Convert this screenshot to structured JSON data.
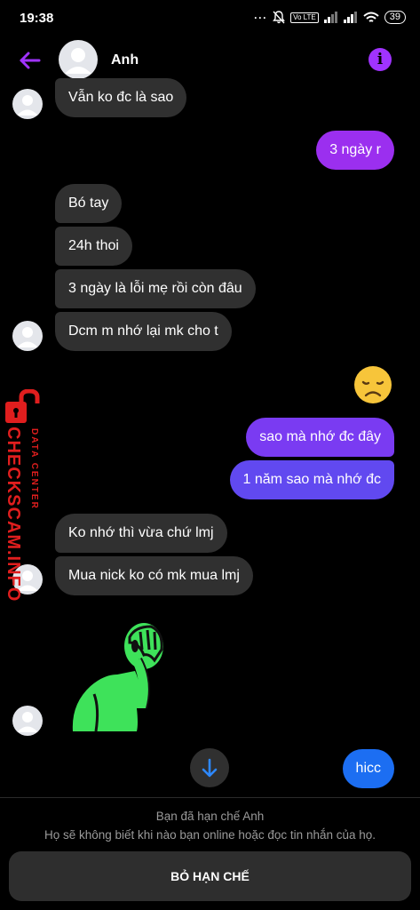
{
  "status_bar": {
    "time": "19:38",
    "dots": "···",
    "network_badge": "Vo LTE",
    "battery": "39"
  },
  "header": {
    "contact_name": "Anh",
    "back_icon": "arrow-left-icon",
    "info_icon": "info-icon",
    "info_glyph": "i"
  },
  "messages": {
    "m1": "Vẫn ko đc là sao",
    "m2": "3 ngày r",
    "m3": "Bó tay",
    "m4": "24h thoi",
    "m5": "3 ngày là lỗi mẹ rồi còn đâu",
    "m6": "Dcm m nhớ lại mk cho t",
    "m7": "sao mà nhớ đc đây",
    "m8": "1 năm sao mà nhớ đc",
    "m9": "Ko nhớ thì vừa chứ lmj",
    "m10": "Mua nick ko có mk mua lmj",
    "m11": "hicc"
  },
  "stickers": {
    "emoji": "disappointed-face-emoji",
    "sticker": "facepalm-figure-sticker"
  },
  "watermark": {
    "main": "CHECKSCAM.INFO",
    "sub": "DATA CENTER"
  },
  "footer": {
    "title": "Bạn đã hạn chế Anh",
    "description": "Họ sẽ không biết khi nào bạn online hoặc đọc tin nhắn của họ.",
    "button": "BỎ HẠN CHẾ"
  },
  "colors": {
    "incoming_bubble": "#303030",
    "accent_purple": "#a033ff",
    "outgoing_purple": "#8e2df5",
    "outgoing_indigo": "#6a4cf0",
    "outgoing_blue": "#1c6ef2",
    "sticker_green": "#3ee25a",
    "watermark_red": "#e01e1e"
  }
}
